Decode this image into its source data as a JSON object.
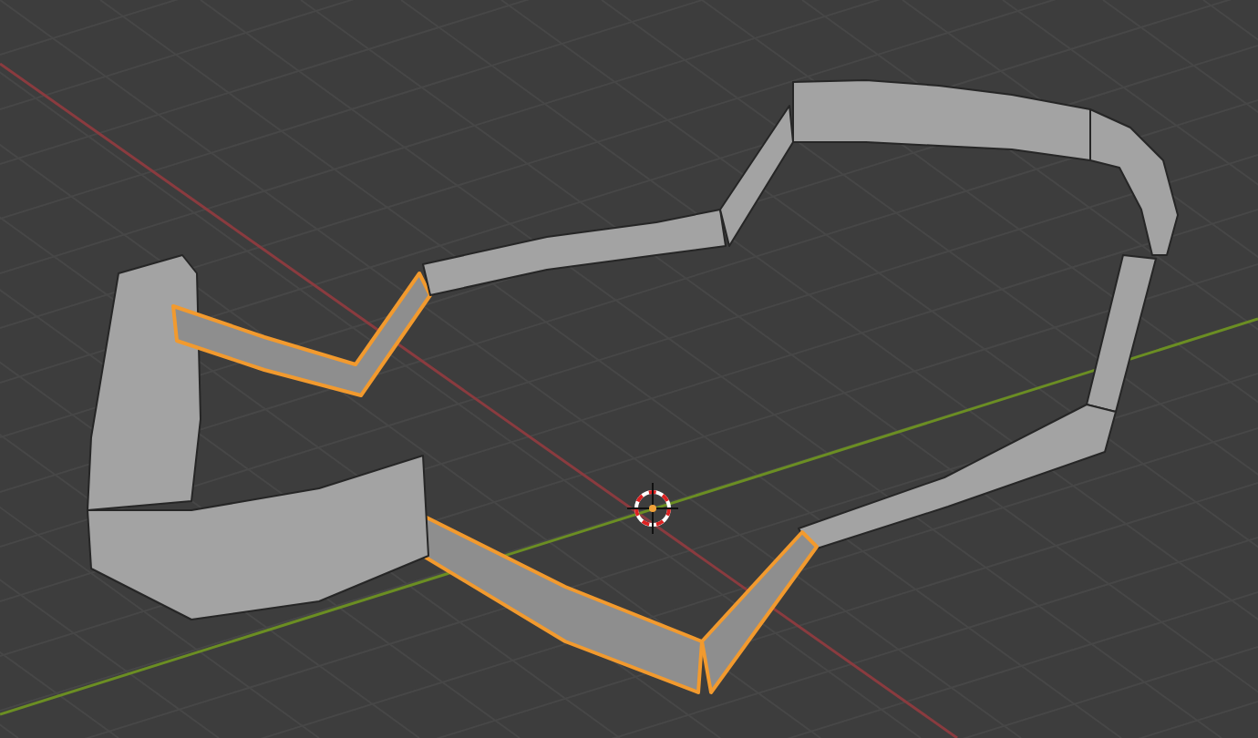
{
  "viewport": {
    "mesh_segments": [
      {
        "selected": false
      },
      {
        "selected": false
      },
      {
        "selected": false
      },
      {
        "selected": false
      },
      {
        "selected": true
      },
      {
        "selected": true
      },
      {
        "selected": false
      },
      {
        "selected": false
      },
      {
        "selected": true
      },
      {
        "selected": false
      },
      {
        "selected": false
      }
    ]
  }
}
